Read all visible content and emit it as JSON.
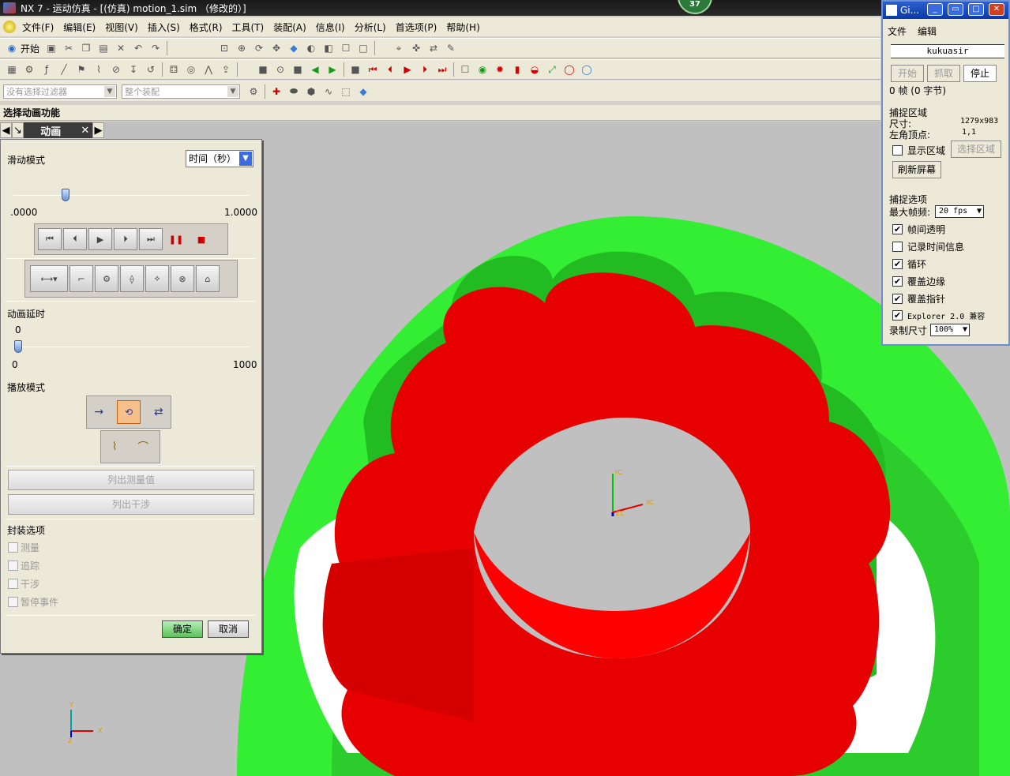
{
  "title": "NX 7 - 运动仿真 - [(仿真) motion_1.sim （修改的）]",
  "badge": "37",
  "menu": {
    "items": [
      "文件(F)",
      "编辑(E)",
      "视图(V)",
      "插入(S)",
      "格式(R)",
      "工具(T)",
      "装配(A)",
      "信息(I)",
      "分析(L)",
      "首选项(P)",
      "帮助(H)"
    ],
    "start_label": "开始"
  },
  "filter": {
    "selection_filter": "没有选择过滤器",
    "assembly": "整个装配"
  },
  "panel": {
    "header": "选择动画功能",
    "tab_label": "动画"
  },
  "dialog": {
    "slide_mode_label": "滑动模式",
    "slide_mode_value": "时间（秒）",
    "slider_min": ".0000",
    "slider_max": "1.0000",
    "slider_position": 0.22,
    "delay_label": "动画延时",
    "delay_value": "0",
    "delay_min": "0",
    "delay_max": "1000",
    "delay_position": 0.0,
    "play_mode_label": "播放模式",
    "list_measure": "列出测量值",
    "list_interference": "列出干涉",
    "envelope_label": "封装选项",
    "envelope_options": [
      "测量",
      "追踪",
      "干涉",
      "暂停事件"
    ],
    "ok": "确定",
    "cancel": "取消"
  },
  "gif": {
    "title": "Gi...",
    "menu": [
      "文件",
      "编辑"
    ],
    "name": "kukuasir",
    "start": "开始",
    "capture": "抓取",
    "stop": "停止",
    "frame_info": "0 帧 (0 字节)",
    "capture_area_label": "捕捉区域",
    "size_label": "尺寸:",
    "size_value": "1279x983",
    "origin_label": "左角顶点:",
    "origin_value": "1,1",
    "show_area": "显示区域",
    "select_area": "选择区域",
    "refresh": "刷新屏幕",
    "capture_options_label": "捕捉选项",
    "max_fps_label": "最大帧频:",
    "max_fps_value": "20 fps",
    "options": [
      {
        "label": "帧间透明",
        "checked": true
      },
      {
        "label": "记录时间信息",
        "checked": false
      },
      {
        "label": "循环",
        "checked": true
      },
      {
        "label": "覆盖边缘",
        "checked": true
      },
      {
        "label": "覆盖指针",
        "checked": true
      },
      {
        "label": "Explorer 2.0 兼容",
        "checked": true
      }
    ],
    "record_size_label": "录制尺寸",
    "record_size_value": "100%"
  },
  "viewport": {
    "axis_labels": {
      "yc": "YC",
      "xc": "XC",
      "zc": "ZC",
      "x": "X",
      "y": "Y",
      "z": "Z"
    },
    "colors": {
      "gear": "#e60000",
      "ring": "#33ee33",
      "background": "#c0c0c0"
    }
  }
}
